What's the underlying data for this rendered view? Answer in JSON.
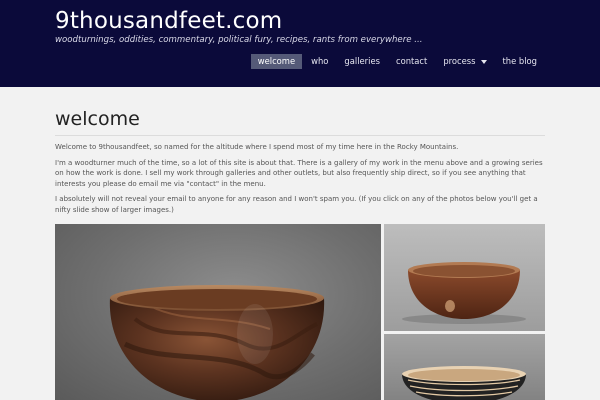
{
  "site": {
    "title": "9thousandfeet.com",
    "tagline": "woodturnings, oddities, commentary, political fury, recipes, rants from everywhere ..."
  },
  "nav": {
    "items": [
      {
        "label": "welcome",
        "active": true
      },
      {
        "label": "who",
        "active": false
      },
      {
        "label": "galleries",
        "active": false
      },
      {
        "label": "contact",
        "active": false
      },
      {
        "label": "process",
        "active": false,
        "has_dropdown": true
      },
      {
        "label": "the blog",
        "active": false
      }
    ]
  },
  "page": {
    "title": "welcome",
    "paragraphs": [
      "Welcome to 9thousandfeet, so named for the altitude where I spend most of my time here in the Rocky Mountains.",
      "I'm a woodturner much of the time, so a lot of this site is about that. There is a gallery of my work in the menu above and a growing series on how the work is done. I sell my work through galleries and other outlets, but also frequently ship direct, so if you see anything that interests you please do email me via  \"contact\" in the menu.",
      "I absolutely will not reveal your email to anyone for any reason and I won't spam you. (If you click on any of the photos below you'll get a nifty slide show of larger images.)"
    ]
  },
  "colors": {
    "header_bg": "#0b0a3a",
    "nav_active_bg": "#555a78",
    "page_bg": "#f2f2f2"
  }
}
